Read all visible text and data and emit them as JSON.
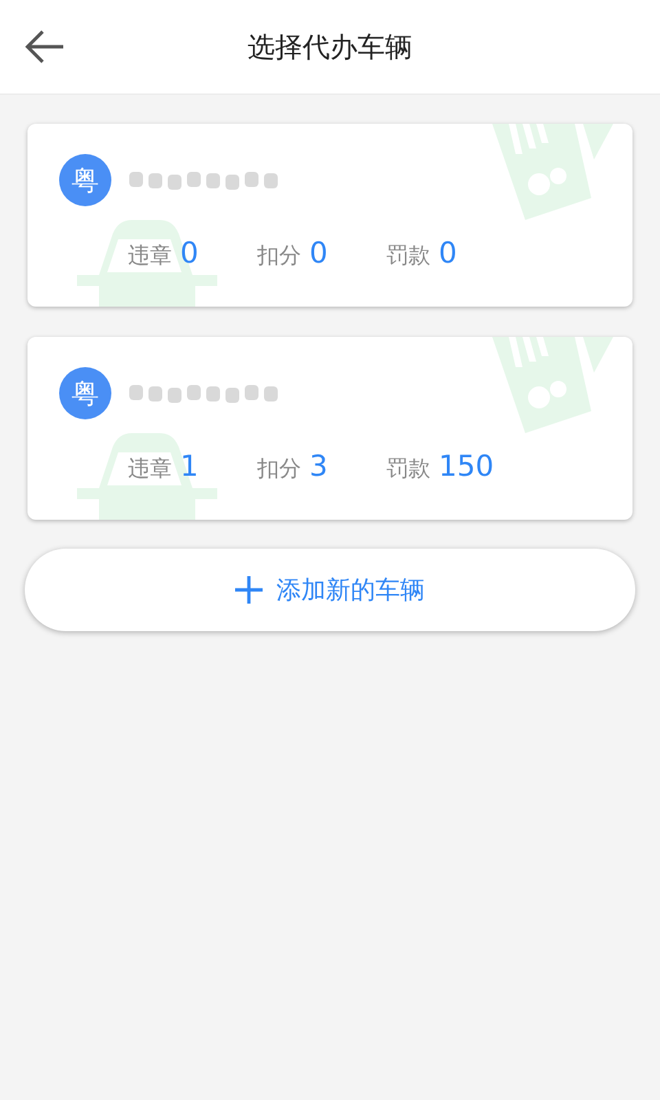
{
  "header": {
    "title": "选择代办车辆"
  },
  "vehicles": [
    {
      "province": "粤",
      "stats": [
        {
          "label": "违章",
          "value": "0"
        },
        {
          "label": "扣分",
          "value": "0"
        },
        {
          "label": "罚款",
          "value": "0"
        }
      ]
    },
    {
      "province": "粤",
      "stats": [
        {
          "label": "违章",
          "value": "1"
        },
        {
          "label": "扣分",
          "value": "3"
        },
        {
          "label": "罚款",
          "value": "150"
        }
      ]
    }
  ],
  "add_button": {
    "label": "添加新的车辆"
  }
}
